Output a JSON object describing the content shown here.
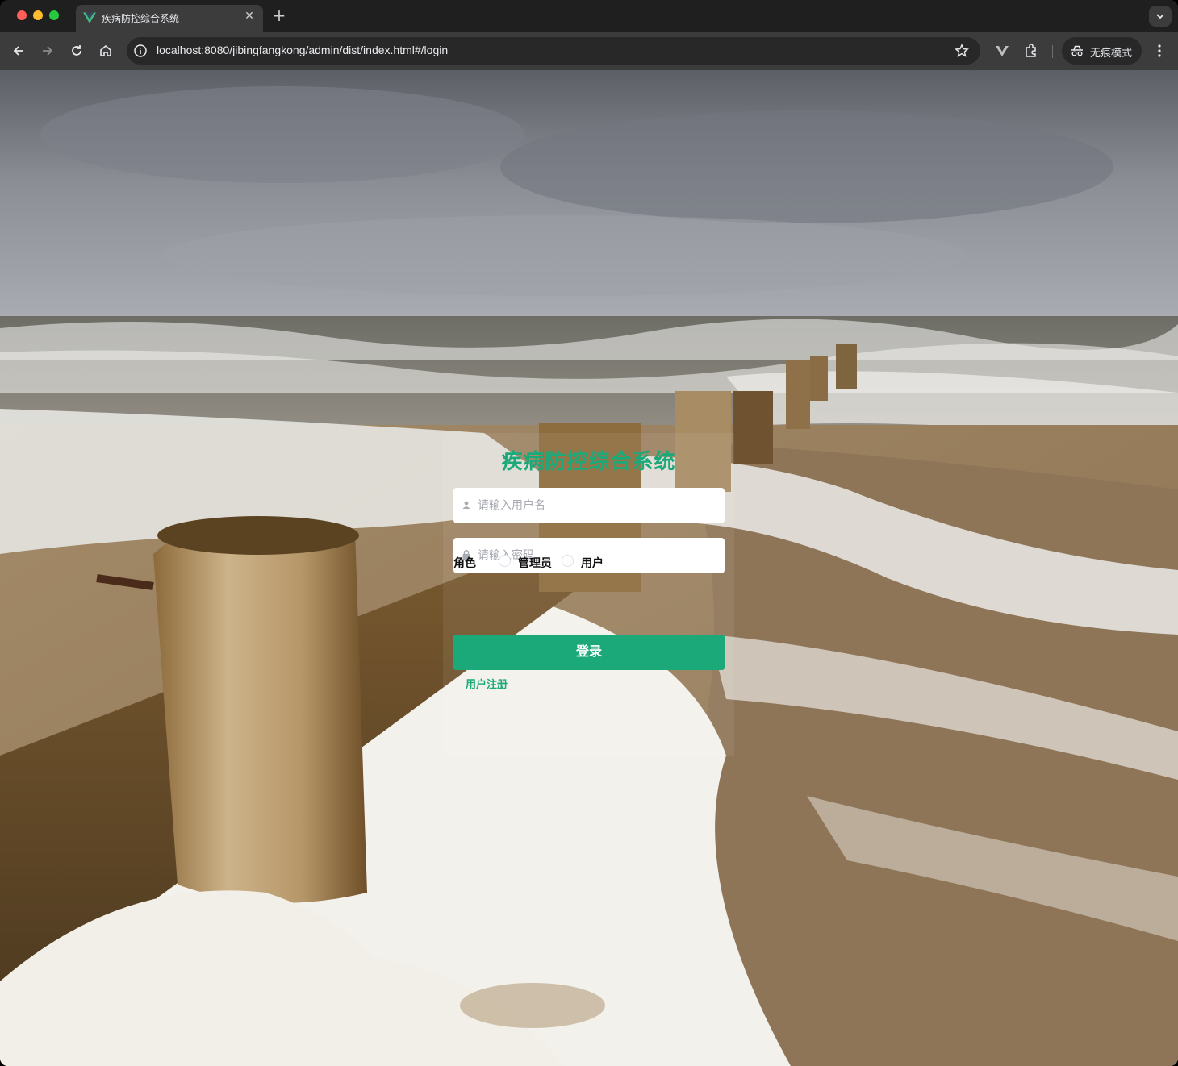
{
  "browser": {
    "tab_title": "疾病防控综合系统",
    "url": "localhost:8080/jibingfangkong/admin/dist/index.html#/login",
    "incognito_label": "无痕模式",
    "icons": [
      "back-icon",
      "forward-icon",
      "reload-icon",
      "home-icon",
      "info-icon",
      "star-icon",
      "vue-devtools-icon",
      "extensions-icon",
      "incognito-icon",
      "menu-icon"
    ]
  },
  "login": {
    "title": "疾病防控综合系统",
    "username_placeholder": "请输入用户名",
    "password_placeholder": "请输入密码",
    "role_label": "角色",
    "roles": [
      "管理员",
      "用户"
    ],
    "login_button": "登录",
    "register_link": "用户注册"
  },
  "colors": {
    "accent": "#1ba97a",
    "chrome_dark": "#1f1f1f",
    "toolbar": "#3c3c3c"
  }
}
